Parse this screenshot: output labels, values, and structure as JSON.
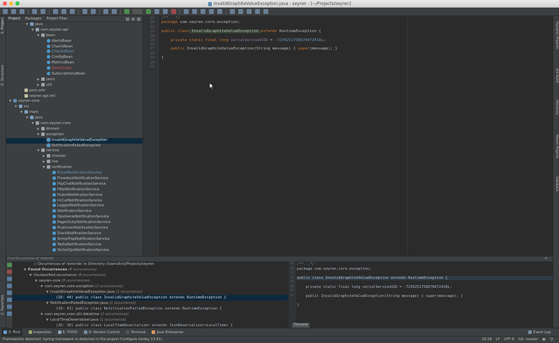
{
  "window": {
    "title": "InvalidGraphiteValueException.java - seyren - [~/Projects/seyren]"
  },
  "left_strip": {
    "project": "1: Project",
    "structure": "Z: Structure",
    "favorites": "2: Favorites"
  },
  "right_strip": {
    "items": [
      "Dynamic Projects",
      "Ant Build",
      "Hierarchy",
      "Maven Projects",
      "Database"
    ]
  },
  "project_panel": {
    "tabs": [
      "Project",
      "Packages",
      "Project Files"
    ],
    "tree": [
      {
        "indent": 4,
        "arrow": "▼",
        "icon": "folder",
        "label": "java"
      },
      {
        "indent": 5,
        "arrow": "▼",
        "icon": "pkg",
        "label": "com.seyren.api"
      },
      {
        "indent": 6,
        "arrow": "▼",
        "icon": "pkg",
        "label": "bean"
      },
      {
        "indent": 7,
        "arrow": "",
        "icon": "cls",
        "label": "AlertsBean"
      },
      {
        "indent": 7,
        "arrow": "",
        "icon": "cls",
        "label": "ChartsBean"
      },
      {
        "indent": 7,
        "arrow": "",
        "icon": "cls",
        "label": "ChecksBean",
        "color": "#6897bb"
      },
      {
        "indent": 7,
        "arrow": "",
        "icon": "cls",
        "label": "ConfigBean"
      },
      {
        "indent": 7,
        "arrow": "",
        "icon": "cls",
        "label": "MetricsBean"
      },
      {
        "indent": 7,
        "arrow": "",
        "icon": "cls",
        "label": "SomeClass",
        "color": "#d25252"
      },
      {
        "indent": 7,
        "arrow": "",
        "icon": "cls",
        "label": "SubscriptionsBean"
      },
      {
        "indent": 6,
        "arrow": "▶",
        "icon": "pkg",
        "label": "jaxrs"
      },
      {
        "indent": 6,
        "arrow": "▶",
        "icon": "pkg",
        "label": "util"
      },
      {
        "indent": 3,
        "arrow": "",
        "icon": "file",
        "label": "pom.xml"
      },
      {
        "indent": 3,
        "arrow": "",
        "icon": "file",
        "label": "seyren-api.iml"
      },
      {
        "indent": 1,
        "arrow": "▼",
        "icon": "mod",
        "label": "seyren-core"
      },
      {
        "indent": 2,
        "arrow": "▼",
        "icon": "folder",
        "label": "src"
      },
      {
        "indent": 3,
        "arrow": "▼",
        "icon": "folder",
        "label": "main"
      },
      {
        "indent": 4,
        "arrow": "▼",
        "icon": "folder",
        "label": "java"
      },
      {
        "indent": 5,
        "arrow": "▼",
        "icon": "pkg",
        "label": "com.seyren.core"
      },
      {
        "indent": 6,
        "arrow": "▶",
        "icon": "pkg",
        "label": "domain"
      },
      {
        "indent": 6,
        "arrow": "▼",
        "icon": "pkg",
        "label": "exception"
      },
      {
        "indent": 7,
        "arrow": "",
        "icon": "cls2",
        "label": "InvalidGraphiteValueException",
        "selected": true
      },
      {
        "indent": 7,
        "arrow": "",
        "icon": "cls2",
        "label": "NotificationFailedException"
      },
      {
        "indent": 6,
        "arrow": "▼",
        "icon": "pkg",
        "label": "service"
      },
      {
        "indent": 7,
        "arrow": "▶",
        "icon": "pkg",
        "label": "checker"
      },
      {
        "indent": 7,
        "arrow": "▶",
        "icon": "pkg",
        "label": "live"
      },
      {
        "indent": 7,
        "arrow": "▼",
        "icon": "pkg",
        "label": "notification"
      },
      {
        "indent": 8,
        "arrow": "",
        "icon": "cls",
        "label": "EmailNotificationService",
        "color": "#6897bb"
      },
      {
        "indent": 8,
        "arrow": "",
        "icon": "cls",
        "label": "FlowdockNotificationService"
      },
      {
        "indent": 8,
        "arrow": "",
        "icon": "cls",
        "label": "HipChatNotificationService"
      },
      {
        "indent": 8,
        "arrow": "",
        "icon": "cls",
        "label": "HttpNotificationService"
      },
      {
        "indent": 8,
        "arrow": "",
        "icon": "cls",
        "label": "HubotNotificationService"
      },
      {
        "indent": 8,
        "arrow": "",
        "icon": "cls",
        "label": "IrcCatNotificationService"
      },
      {
        "indent": 8,
        "arrow": "",
        "icon": "cls",
        "label": "LoggerNotificationService"
      },
      {
        "indent": 8,
        "arrow": "",
        "icon": "cls",
        "label": "NotificationService"
      },
      {
        "indent": 8,
        "arrow": "",
        "icon": "cls",
        "label": "OpsGenieNotificationService"
      },
      {
        "indent": 8,
        "arrow": "",
        "icon": "cls",
        "label": "PagerDutyNotificationService"
      },
      {
        "indent": 8,
        "arrow": "",
        "icon": "cls",
        "label": "PushoverNotificationService"
      },
      {
        "indent": 8,
        "arrow": "",
        "icon": "cls",
        "label": "SlackNotificationService"
      },
      {
        "indent": 8,
        "arrow": "",
        "icon": "cls",
        "label": "SnmpTrapNotificationService"
      },
      {
        "indent": 8,
        "arrow": "",
        "icon": "cls",
        "label": "TwilioNotificationService"
      },
      {
        "indent": 8,
        "arrow": "",
        "icon": "cls",
        "label": "VictorOpsNotificationService"
      }
    ]
  },
  "editor": {
    "line_numbers": [
      "15",
      "16",
      "12",
      "13",
      "14",
      "15",
      "16",
      "17",
      "18",
      "19",
      "20",
      "21"
    ],
    "code": {
      "l0": "/**...*/",
      "l1_kw": "package",
      "l1": " com.seyren.core.exception;",
      "l3_kw1": "public class",
      "l3_name": " InvalidGraphiteValueException ",
      "l3_kw2": "extends",
      "l3_rest": " RuntimeException {",
      "l5_kw": "    private static final long",
      "l5_fld": " serialVersionUID",
      "l5_eq": " = ",
      "l5_num": "-7234251758678472418L",
      "l5_end": ";",
      "l7_kw": "    public",
      "l7_a": " InvalidGraphiteValueException(String message) { ",
      "l7_kw2": "super",
      "l7_b": "(message); }",
      "l9": "}"
    }
  },
  "find": {
    "header": "Find Occurrences of 'extends'",
    "title": "Occurrences of 'extends' in Directory /Users/kris/Projects/seyren",
    "rows": [
      {
        "indent": 0,
        "arrow": "▼",
        "text": "Found Occurrences",
        "count": "(8 occurrences)",
        "bold": true
      },
      {
        "indent": 1,
        "arrow": "▼",
        "text": "Unclassified occurrence",
        "count": "(8 occurrences)"
      },
      {
        "indent": 2,
        "arrow": "▼",
        "text": "seyren-core",
        "count": "(8 occurrences)"
      },
      {
        "indent": 3,
        "arrow": "▼",
        "text": "com.seyren.core.exception",
        "count": "(2 occurrences)"
      },
      {
        "indent": 4,
        "arrow": "▼",
        "text": "InvalidGraphiteValueException.java",
        "count": "(1 occurrence)"
      },
      {
        "indent": 5,
        "arrow": "",
        "text": "(16: 44) public class InvalidGraphiteValueException extends RuntimeException {",
        "count": "",
        "selected": true
      },
      {
        "indent": 4,
        "arrow": "▼",
        "text": "NotificationFailedException.java",
        "count": "(1 occurrence)"
      },
      {
        "indent": 5,
        "arrow": "",
        "text": "(16: 42) public class NotificationFailedException extends RuntimeException {",
        "count": ""
      },
      {
        "indent": 3,
        "arrow": "▼",
        "text": "com.seyren.core.util.datetime",
        "count": "(2 occurrences)"
      },
      {
        "indent": 4,
        "arrow": "▼",
        "text": "LocalTimeDeserializer.java",
        "count": "(1 occurrence)"
      },
      {
        "indent": 5,
        "arrow": "",
        "text": "(26: 30) public class LocalTimeDeserializer extends JsonDeserializer<LocalTime> {",
        "count": ""
      }
    ]
  },
  "preview": {
    "line_numbers": [
      "15",
      "16",
      "17",
      "18",
      "19",
      "20",
      "21",
      "22"
    ],
    "lines": [
      "/**...*/",
      "package com.seyren.core.exception;",
      "",
      "public class InvalidGraphiteValueException extends RuntimeException {",
      "",
      "    private static final long serialVersionUID = -7234251758678472418L;",
      "",
      "    public InvalidGraphiteValueException(String message) { super(message); }",
      "",
      "}"
    ],
    "tab": "Preview"
  },
  "bottom_tabs": [
    {
      "label": "3: Find",
      "active": true,
      "color": "#6a9fd4"
    },
    {
      "label": "Inspection",
      "color": "#9aa36b"
    },
    {
      "label": "6: TODO",
      "color": "#8fa3b3"
    },
    {
      "label": "9: Version Control",
      "color": "#7a8fa6"
    },
    {
      "label": "Terminal",
      "color": "#555"
    },
    {
      "label": "Java Enterprise",
      "color": "#d69b5a"
    }
  ],
  "event_log": "Event Log",
  "status": {
    "message": "Frameworks detected: Spring framework is detected in the project Configure (today 13:41)",
    "right": [
      "16:28",
      "LF",
      "UTF-8",
      "Git: master"
    ]
  }
}
